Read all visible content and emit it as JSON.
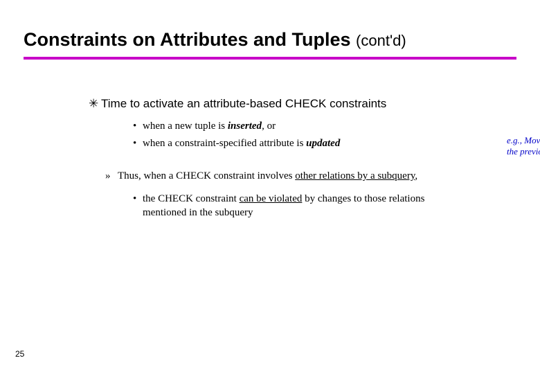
{
  "title": {
    "main": "Constraints on Attributes and Tuples",
    "contd": "(cont'd)"
  },
  "bullet1": {
    "star": "✳",
    "text": "Time to activate an attribute-based CHECK constraints"
  },
  "sub1": {
    "a": "when a new tuple is ",
    "b": "inserted",
    "c": ", or"
  },
  "sub2": {
    "a": "when a constraint-specified attribute is ",
    "b": "updated"
  },
  "note": {
    "a": "e.g., Movie.Exec in",
    "b": "the previous example"
  },
  "thus": {
    "a": "Thus, when a CHECK constraint involves ",
    "b": "other relations by a subquery",
    "c": ","
  },
  "consq": {
    "a": "the CHECK constraint ",
    "b": "can be violated",
    "c": " by changes to those relations mentioned in the subquery"
  },
  "pagenum": "25"
}
